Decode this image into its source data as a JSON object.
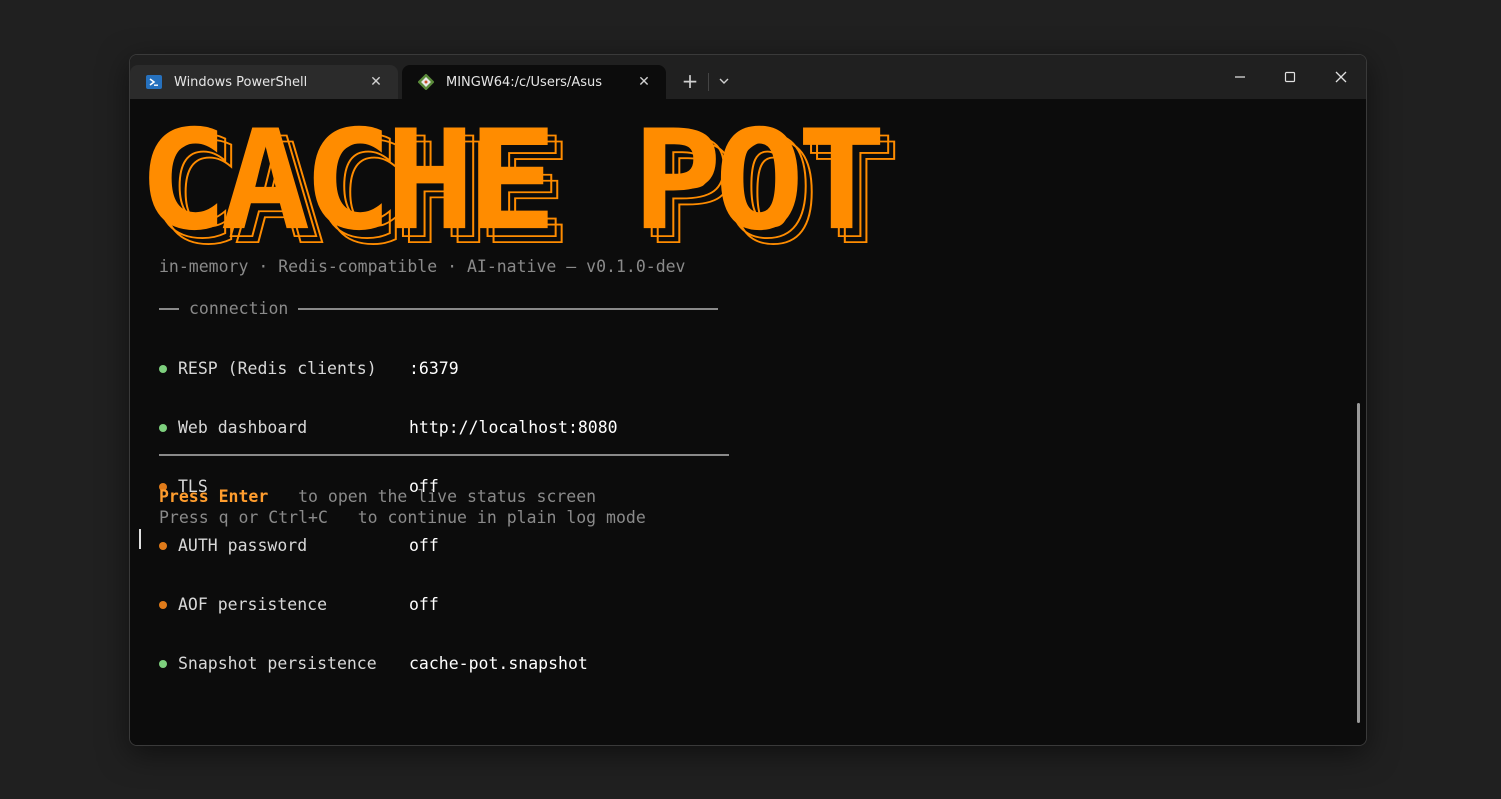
{
  "tabs": [
    {
      "label": "Windows PowerShell",
      "icon": "powershell-icon",
      "active": false
    },
    {
      "label": "MINGW64:/c/Users/Asus",
      "icon": "git-bash-icon",
      "active": true
    }
  ],
  "banner": {
    "text": "CACHE POT",
    "color": "#ff8c00"
  },
  "subtitle": "in-memory · Redis-compatible · AI-native — v0.1.0-dev",
  "connection": {
    "heading": "connection",
    "rows": [
      {
        "label": "RESP (Redis clients)",
        "value": ":6379",
        "status": "on",
        "dot_color": "#7ed07e"
      },
      {
        "label": "Web dashboard",
        "value": "http://localhost:8080",
        "status": "on",
        "dot_color": "#7ed07e"
      },
      {
        "label": "TLS",
        "value": "off",
        "status": "off",
        "dot_color": "#e07b1a"
      },
      {
        "label": "AUTH password",
        "value": "off",
        "status": "off",
        "dot_color": "#e07b1a"
      },
      {
        "label": "AOF persistence",
        "value": "off",
        "status": "off",
        "dot_color": "#e07b1a"
      },
      {
        "label": "Snapshot persistence",
        "value": "cache-pot.snapshot",
        "status": "on",
        "dot_color": "#7ed07e"
      }
    ]
  },
  "hints": [
    {
      "key": "Press Enter",
      "action": "to open the live status screen"
    },
    {
      "key": "Press q or Ctrl+C",
      "action": "to continue in plain log mode"
    }
  ],
  "colors": {
    "accent": "#ff8c00",
    "muted": "#8a8a8a",
    "terminal_bg": "#0c0c0c",
    "titlebar_bg": "#202020"
  }
}
